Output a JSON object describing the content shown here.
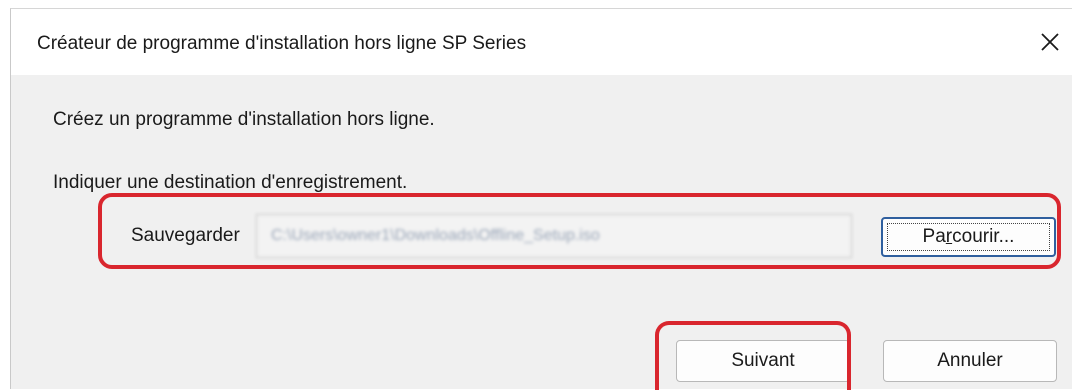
{
  "window": {
    "title": "Créateur de programme d'installation hors ligne SP Series",
    "close_icon": "close-icon"
  },
  "content": {
    "message": "Créez un programme d'installation hors ligne.",
    "instruction": "Indiquer une destination d'enregistrement.",
    "save_label": "Sauvegarder",
    "save_path": "C:\\Users\\owner1\\Downloads\\Offline_Setup.iso",
    "browse_prefix": "Pa",
    "browse_underlined": "r",
    "browse_suffix": "courir..."
  },
  "buttons": {
    "next": "Suivant",
    "cancel": "Annuler"
  },
  "colors": {
    "highlight": "#d9262e",
    "focus_border": "#2f5f9e"
  }
}
